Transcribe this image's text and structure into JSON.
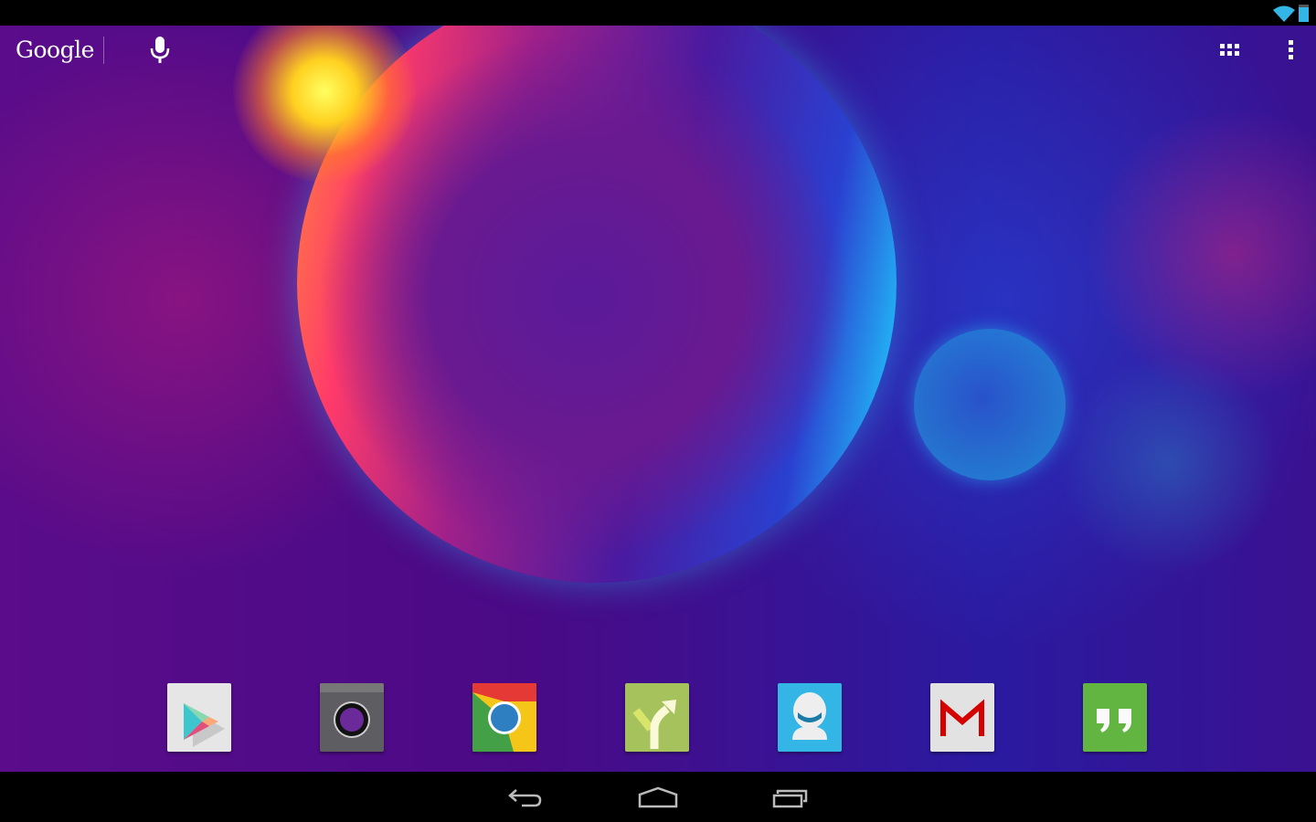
{
  "search_bar": {
    "label": "Google",
    "voice_icon": "microphone-icon"
  },
  "status_bar": {
    "icons": [
      "wifi-icon",
      "battery-icon"
    ],
    "accent": "#33b5e5"
  },
  "top_right": {
    "apps_icon": "app-drawer-icon",
    "menu_icon": "overflow-menu-icon"
  },
  "dock": {
    "apps": [
      {
        "app": "play-store",
        "color": "#e8e8e8"
      },
      {
        "app": "camera",
        "color": "#5a5a5e"
      },
      {
        "app": "chrome",
        "color": "#e53935"
      },
      {
        "app": "navigation",
        "color": "#a5c25c"
      },
      {
        "app": "contacts",
        "color": "#33b5e5"
      },
      {
        "app": "gmail",
        "color": "#e0e0e0"
      },
      {
        "app": "hangouts",
        "color": "#63b541"
      }
    ]
  },
  "nav_bar": {
    "icons": [
      "back-icon",
      "home-icon",
      "recents-icon"
    ]
  }
}
